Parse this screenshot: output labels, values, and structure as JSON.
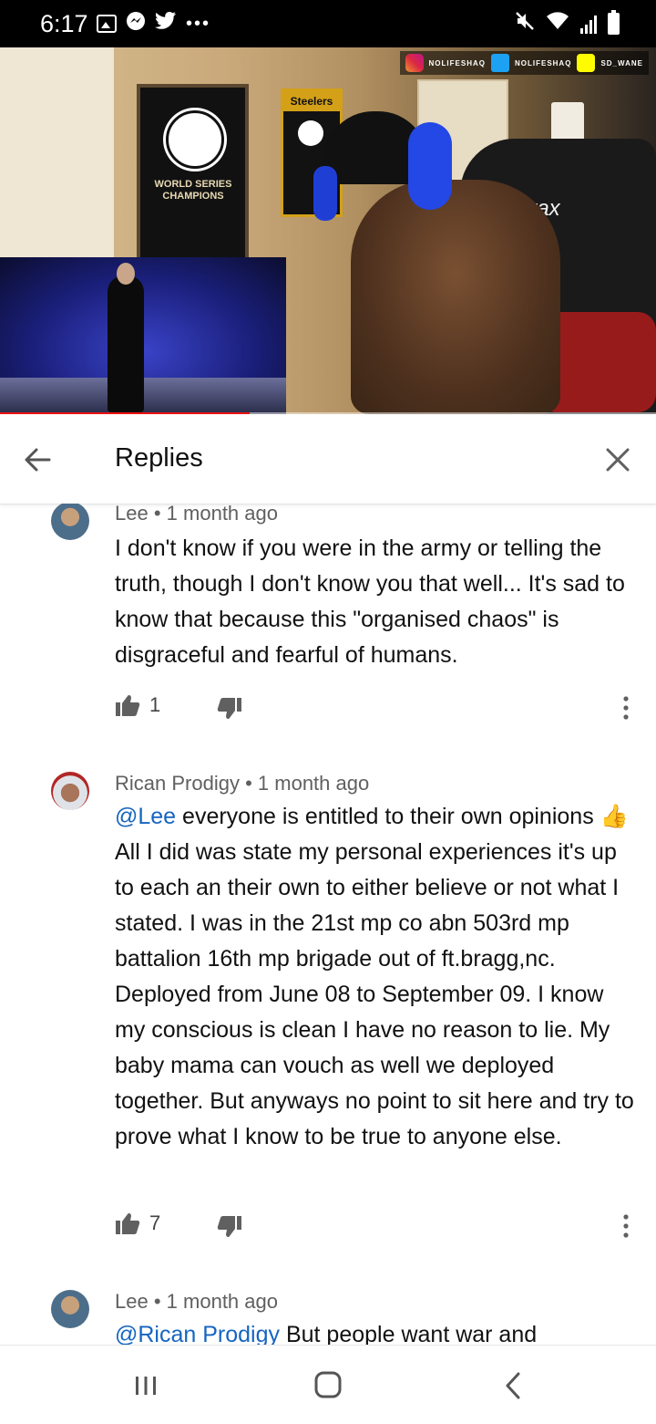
{
  "status_bar": {
    "time": "6:17",
    "left_icons": [
      "gallery-icon",
      "messenger-icon",
      "twitter-icon",
      "more-dots-icon"
    ],
    "more_dots": "•••",
    "right_icons": [
      "mute-icon",
      "wifi-icon",
      "signal-icon",
      "battery-icon"
    ]
  },
  "video": {
    "social_overlay": {
      "instagram": "NOLIFESHAQ",
      "twitter": "NOLIFESHAQ",
      "snapchat": "SD_WANE"
    },
    "banner_yankees_text": "WORLD SERIES CHAMPIONS",
    "banner_steelers_text": "Steelers",
    "chair_brand": "Merax",
    "progress_fraction": 0.38
  },
  "header": {
    "title": "Replies"
  },
  "comments": [
    {
      "author": "Lee",
      "time": "1 month ago",
      "mention": "",
      "text": "I don't know if you were in the army or telling the truth, though I don't know you that well... It's sad to know that because this \"organised chaos\" is disgraceful and fearful of humans.",
      "likes": "1"
    },
    {
      "author": "Rican Prodigy",
      "time": "1 month ago",
      "mention": "@Lee",
      "text": " everyone is entitled to their own opinions 👍 All I did was state my personal experiences it's up to each an their own to either believe or not what I stated. I was in the 21st mp co abn 503rd mp battalion 16th mp brigade out of ft.bragg,nc. Deployed from June 08 to September 09. I know my conscious is clean I have no reason to lie. My baby mama can vouch as well we deployed together. But anyways no point to sit here and try to prove what I know to be true to anyone else.",
      "likes": "7"
    },
    {
      "author": "Lee",
      "time": "1 month ago",
      "mention": "@Rican Prodigy",
      "text": " But people want war and",
      "likes": ""
    }
  ],
  "meta_separator": "•",
  "colors": {
    "mention": "#1565c0",
    "meta": "#606060",
    "progress": "#ee1111"
  }
}
